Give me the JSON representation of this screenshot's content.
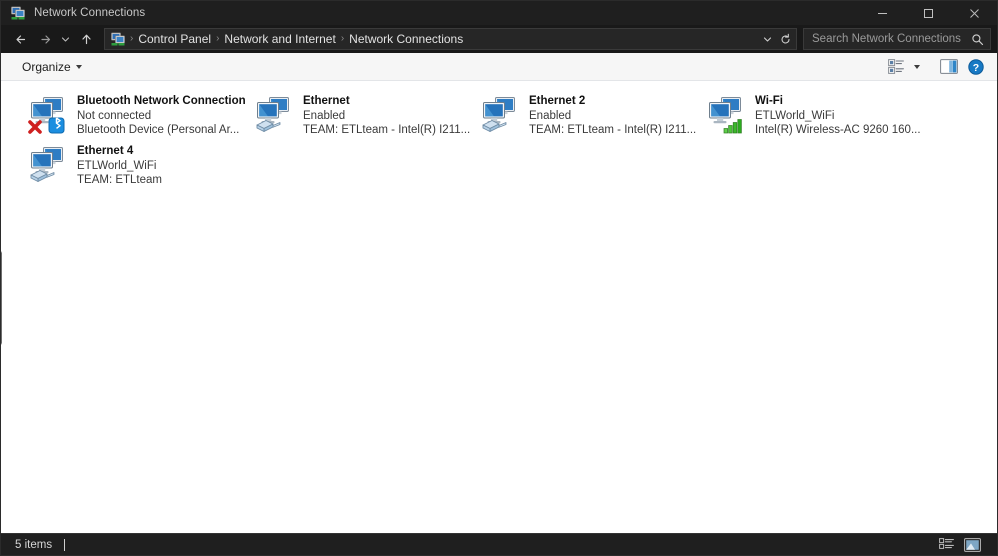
{
  "window": {
    "title": "Network Connections",
    "app_icon": "network-connections-icon",
    "controls": {
      "minimize": "minimize-button",
      "maximize": "maximize-button",
      "close": "close-button"
    }
  },
  "addressbar": {
    "back": "back-button",
    "forward": "forward-button",
    "recent": "recent-locations-button",
    "up": "up-button",
    "crumb_icon": "control-panel-icon",
    "breadcrumbs": [
      {
        "label": "Control Panel"
      },
      {
        "label": "Network and Internet"
      },
      {
        "label": "Network Connections"
      }
    ],
    "separator": "›",
    "dropdown": "previous-locations-button",
    "refresh": "refresh-button",
    "search": {
      "placeholder": "Search Network Connections",
      "value": "",
      "icon": "search-icon"
    }
  },
  "toolbar": {
    "organize_label": "Organize",
    "view_options": "change-view-button",
    "view_dropdown": "change-view-dropdown",
    "preview_pane": "preview-pane-button",
    "help": "help-button"
  },
  "connections": [
    {
      "name": "Bluetooth Network Connection",
      "status": "Not connected",
      "device": "Bluetooth Device (Personal Ar...",
      "icon": "network-adapter-icon",
      "badge": "bluetooth-badge",
      "overlay": "disconnected-x-overlay",
      "badge_color": "#0b7fd4"
    },
    {
      "name": "Ethernet",
      "status": "Enabled",
      "device": "TEAM: ETLteam - Intel(R) I211...",
      "icon": "network-adapter-icon",
      "badge": "ethernet-plug-badge",
      "overlay": "",
      "badge_color": "#9fc8e8"
    },
    {
      "name": "Ethernet 2",
      "status": "Enabled",
      "device": "TEAM: ETLteam - Intel(R) I211...",
      "icon": "network-adapter-icon",
      "badge": "ethernet-plug-badge",
      "overlay": "",
      "badge_color": "#9fc8e8"
    },
    {
      "name": "Wi-Fi",
      "status": "ETLWorld_WiFi",
      "device": "Intel(R) Wireless-AC 9260 160...",
      "icon": "network-adapter-icon",
      "badge": "wifi-signal-badge",
      "overlay": "",
      "badge_color": "#3faa2e"
    },
    {
      "name": "Ethernet 4",
      "status": "ETLWorld_WiFi",
      "device": "TEAM: ETLteam",
      "icon": "network-adapter-icon",
      "badge": "ethernet-plug-badge",
      "overlay": "",
      "badge_color": "#9fc8e8"
    }
  ],
  "statusbar": {
    "item_count": "5 items",
    "details_view": "details-view-button",
    "large_icons_view": "large-icons-view-button"
  }
}
